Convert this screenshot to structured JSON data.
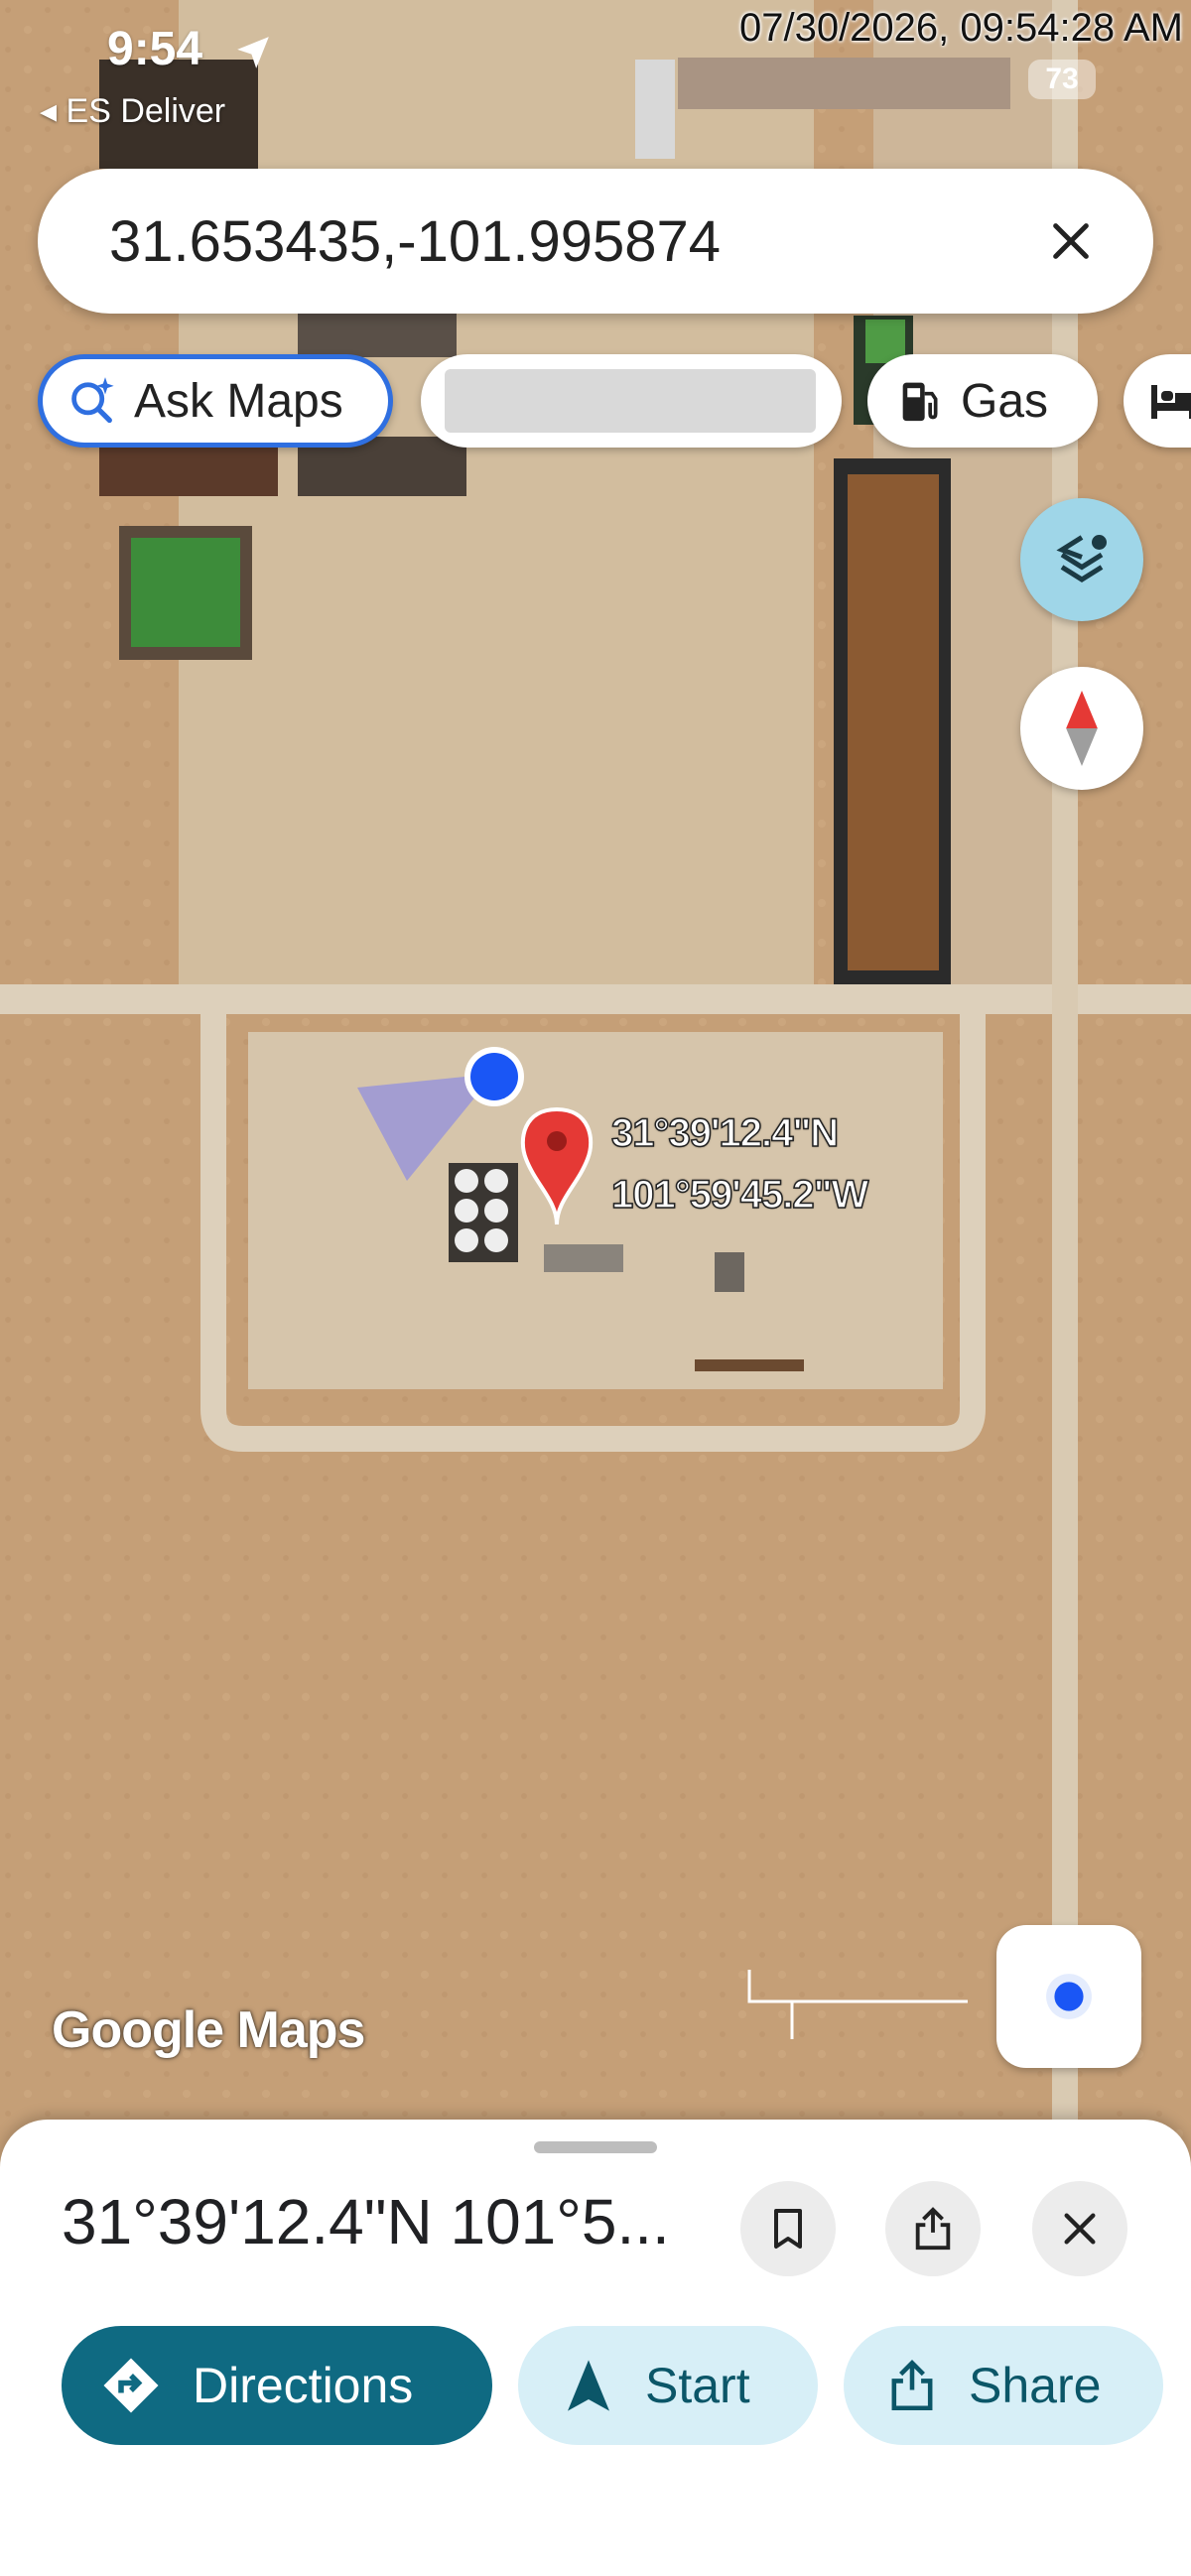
{
  "overlay_timestamp": "07/30/2026, 09:54:28 AM",
  "status_bar": {
    "time": "9:54",
    "back_app": "ES Deliver",
    "battery": "73"
  },
  "search": {
    "value": "31.653435,-101.995874"
  },
  "chips": [
    {
      "label": "Ask Maps"
    },
    {
      "label": ""
    },
    {
      "label": "Gas"
    }
  ],
  "map": {
    "pin_lat": "31°39'12.4\"N",
    "pin_lng": "101°59'45.2\"W",
    "watermark": "Google Maps"
  },
  "sheet": {
    "title": "31°39'12.4\"N 101°5...",
    "actions": {
      "directions": "Directions",
      "start": "Start",
      "share": "Share"
    }
  },
  "colors": {
    "accent": "#2f6fe0",
    "primary_button": "#0f6a82",
    "secondary_button": "#d7eff7",
    "pin": "#e53935",
    "location_dot": "#1a56f5"
  },
  "icons": [
    "navigation-arrow-icon",
    "back-caret-icon",
    "close-icon",
    "ask-maps-sparkle-icon",
    "gas-pump-icon",
    "hotel-bed-icon",
    "layers-icon",
    "compass-icon",
    "my-location-icon",
    "bookmark-icon",
    "share-icon",
    "directions-icon",
    "start-arrow-icon"
  ]
}
